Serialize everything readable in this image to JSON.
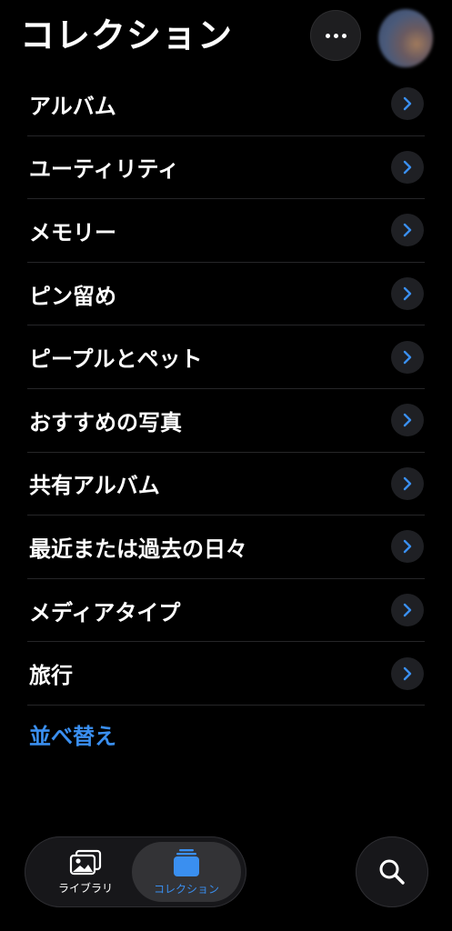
{
  "header": {
    "title": "コレクション",
    "more_icon": "ellipsis-icon",
    "avatar": "profile-avatar"
  },
  "list": {
    "items": [
      {
        "label": "アルバム"
      },
      {
        "label": "ユーティリティ"
      },
      {
        "label": "メモリー"
      },
      {
        "label": "ピン留め"
      },
      {
        "label": "ピープルとペット"
      },
      {
        "label": "おすすめの写真"
      },
      {
        "label": "共有アルバム"
      },
      {
        "label": "最近または過去の日々"
      },
      {
        "label": "メディアタイプ"
      },
      {
        "label": "旅行"
      }
    ],
    "chevron_icon": "chevron-right-icon"
  },
  "sort_label": "並べ替え",
  "tabbar": {
    "library_label": "ライブラリ",
    "collection_label": "コレクション",
    "selected": "コレクション"
  },
  "search_icon": "search-icon",
  "colors": {
    "background": "#000000",
    "accent": "#3a8ff0",
    "chevron_button": "#1f2024",
    "divider": "#262628"
  }
}
